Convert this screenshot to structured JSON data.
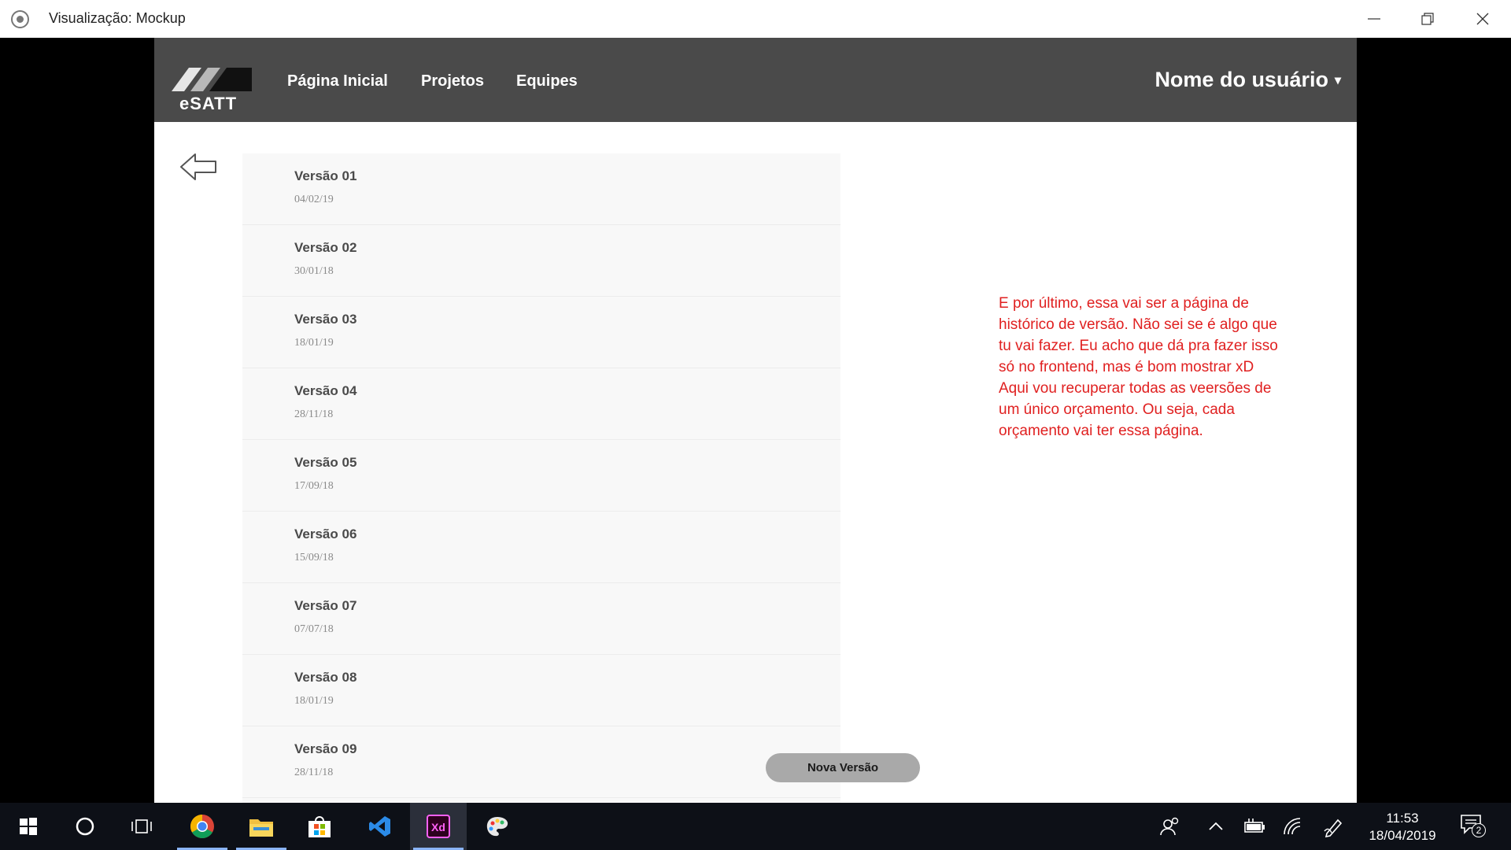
{
  "window": {
    "title": "Visualização: Mockup"
  },
  "navbar": {
    "logo_text": "eSATT",
    "items": [
      {
        "label": "Página Inicial"
      },
      {
        "label": "Projetos"
      },
      {
        "label": "Equipes"
      }
    ],
    "user_name": "Nome do usuário",
    "user_caret": "▾"
  },
  "versions": [
    {
      "name": "Versão 01",
      "date": "04/02/19"
    },
    {
      "name": "Versão 02",
      "date": "30/01/18"
    },
    {
      "name": "Versão 03",
      "date": "18/01/19"
    },
    {
      "name": "Versão 04",
      "date": "28/11/18"
    },
    {
      "name": "Versão 05",
      "date": "17/09/18"
    },
    {
      "name": "Versão 06",
      "date": "15/09/18"
    },
    {
      "name": "Versão 07",
      "date": "07/07/18"
    },
    {
      "name": "Versão 08",
      "date": "18/01/19"
    },
    {
      "name": "Versão 09",
      "date": "28/11/18"
    }
  ],
  "new_version_label": "Nova Versão",
  "annotation": "E por último, essa vai ser a página de histórico de versão. Não sei se é algo que tu vai fazer. Eu acho que dá pra fazer isso só no frontend, mas é bom mostrar xD Aqui vou recuperar todas as veersões de um único orçamento. Ou seja, cada orçamento vai ter essa página.",
  "taskbar": {
    "time": "11:53",
    "date": "18/04/2019",
    "notification_count": "2"
  },
  "colors": {
    "navbar": "#4a4a4a",
    "annotation": "#e02020",
    "button": "#a9a9a9"
  }
}
